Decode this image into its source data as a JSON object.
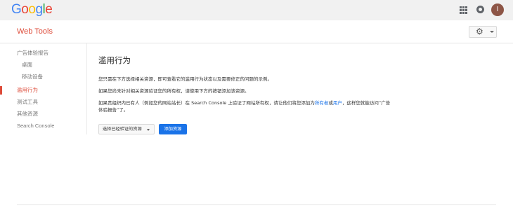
{
  "header": {
    "logo_letters": [
      {
        "char": "G",
        "color": "#4285F4"
      },
      {
        "char": "o",
        "color": "#EA4335"
      },
      {
        "char": "o",
        "color": "#FBBC05"
      },
      {
        "char": "g",
        "color": "#4285F4"
      },
      {
        "char": "l",
        "color": "#34A853"
      },
      {
        "char": "e",
        "color": "#EA4335"
      }
    ],
    "icons": [
      "apps-grid-icon",
      "notifications-icon"
    ],
    "avatar_initial": "I",
    "avatar_color": "#8d5546"
  },
  "appbar": {
    "title": "Web Tools",
    "title_color": "#dd4b39",
    "settings_icon": "gear-icon"
  },
  "sidebar": {
    "items": [
      {
        "label": "广告体验报告"
      },
      {
        "label": "桌面"
      },
      {
        "label": "移动设备"
      },
      {
        "label": "滥用行为"
      },
      {
        "label": "测试工具"
      },
      {
        "label": "其他资源"
      },
      {
        "label": "Search Console"
      }
    ],
    "active_color": "#dd4b39"
  },
  "main": {
    "title": "滥用行为",
    "para1": "您只需在下方选择相关资源，即可查看它的滥用行为状态以及需要修正的问题的示例。",
    "para2": "如果您尚未针对相关资源验证您的所有权，请使用下方的按钮添加该资源。",
    "para3_a": "如果贵组织内已有人（例如您的网站站长）在 Search Console 上验证了网站所有权，请让他们将您添加为",
    "para3_link1": "所有者",
    "para3_b": "或",
    "para3_link2": "用户",
    "para3_c": "，这样您就能访问“广告体验报告”了。",
    "select_value": "选择已经验证的资源",
    "add_button": "添加资源",
    "accent_color": "#1a73e8"
  }
}
